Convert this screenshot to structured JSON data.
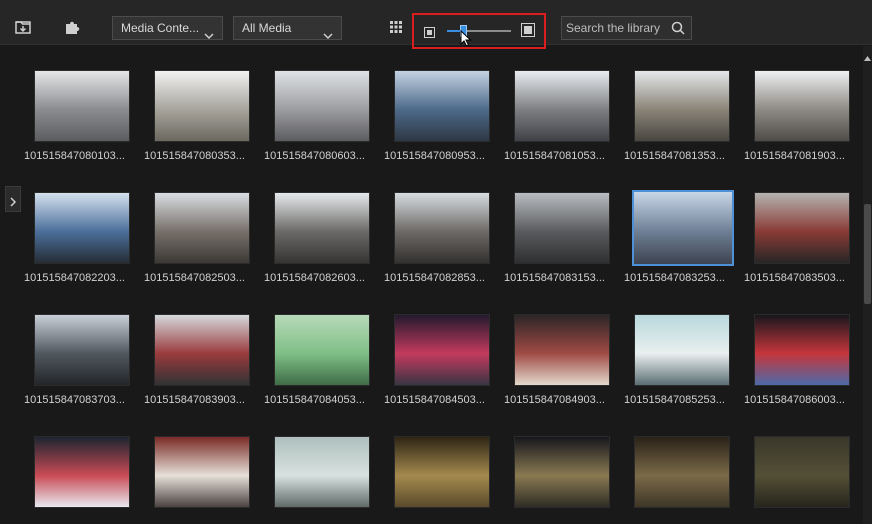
{
  "toolbar": {
    "icons": {
      "import": "import-media-icon",
      "plugins": "puzzle-piece-icon",
      "grid": "grid-view-icon"
    },
    "media_content_dropdown": "Media Conte...",
    "filter_dropdown": "All Media",
    "thumbnail_size": 0.25,
    "search_placeholder": "Search the library"
  },
  "library": {
    "selected_index": 12,
    "items": [
      {
        "label": "101515847080103...",
        "colors": [
          "#e5e6e8",
          "#8a8c8f",
          "#5b5d60"
        ]
      },
      {
        "label": "101515847080353...",
        "colors": [
          "#f2f2f2",
          "#a7a49c",
          "#6b6860"
        ]
      },
      {
        "label": "101515847080603...",
        "colors": [
          "#dfe2e6",
          "#9c9da0",
          "#5c5d60"
        ]
      },
      {
        "label": "101515847080953...",
        "colors": [
          "#c3d2e2",
          "#4e6a8a",
          "#2d3744"
        ]
      },
      {
        "label": "101515847081053...",
        "colors": [
          "#e8ecf0",
          "#7e7f82",
          "#3f4148"
        ]
      },
      {
        "label": "101515847081353...",
        "colors": [
          "#e4e7ea",
          "#8b8578",
          "#494641"
        ]
      },
      {
        "label": "101515847081903...",
        "colors": [
          "#eef0f2",
          "#8e8a84",
          "#4f4b47"
        ]
      },
      {
        "label": "101515847082203...",
        "colors": [
          "#d4e1ee",
          "#4b6f9a",
          "#252d36"
        ]
      },
      {
        "label": "101515847082503...",
        "colors": [
          "#d9dde2",
          "#77706a",
          "#3c3935"
        ]
      },
      {
        "label": "101515847082603...",
        "colors": [
          "#e6e9ec",
          "#6c6a68",
          "#353433"
        ]
      },
      {
        "label": "101515847082853...",
        "colors": [
          "#d7dce0",
          "#6d6a67",
          "#33312f"
        ]
      },
      {
        "label": "101515847083153...",
        "colors": [
          "#b9bdc1",
          "#5a5b5e",
          "#2e2f30"
        ]
      },
      {
        "label": "101515847083253...",
        "colors": [
          "#c8d6e8",
          "#6e7f95",
          "#3d4350"
        ]
      },
      {
        "label": "101515847083503...",
        "colors": [
          "#b4b3b0",
          "#8a3b36",
          "#262626"
        ]
      },
      {
        "label": "101515847083703...",
        "colors": [
          "#c9cfd6",
          "#50585f",
          "#232629"
        ]
      },
      {
        "label": "101515847083903...",
        "colors": [
          "#d5d9dd",
          "#9a3b3d",
          "#303234"
        ]
      },
      {
        "label": "101515847084053...",
        "colors": [
          "#b7d9b8",
          "#7fbf86",
          "#3f6d47"
        ]
      },
      {
        "label": "101515847084503...",
        "colors": [
          "#221a2e",
          "#c33a5e",
          "#3a3544"
        ]
      },
      {
        "label": "101515847084903...",
        "colors": [
          "#2c2527",
          "#a04b45",
          "#e3d8cc"
        ]
      },
      {
        "label": "101515847085253...",
        "colors": [
          "#b9d9dd",
          "#e9efef",
          "#5c6f74"
        ]
      },
      {
        "label": "101515847086003...",
        "colors": [
          "#17171c",
          "#c5363c",
          "#4d6aa8"
        ]
      },
      {
        "label": "",
        "colors": [
          "#1c2430",
          "#c94b55",
          "#e8e8f0"
        ]
      },
      {
        "label": "",
        "colors": [
          "#7a2a26",
          "#e6e0d8",
          "#4c4342"
        ]
      },
      {
        "label": "",
        "colors": [
          "#aebfbd",
          "#d8e2e0",
          "#5f6a69"
        ]
      },
      {
        "label": "",
        "colors": [
          "#2d2514",
          "#a58a4e",
          "#5a4a2a"
        ]
      },
      {
        "label": "",
        "colors": [
          "#17171c",
          "#8a7a52",
          "#2e2c24"
        ]
      },
      {
        "label": "",
        "colors": [
          "#2a2218",
          "#7a6a48",
          "#3e3626"
        ]
      },
      {
        "label": "",
        "colors": [
          "#39372a",
          "#545036",
          "#26251c"
        ]
      }
    ]
  }
}
